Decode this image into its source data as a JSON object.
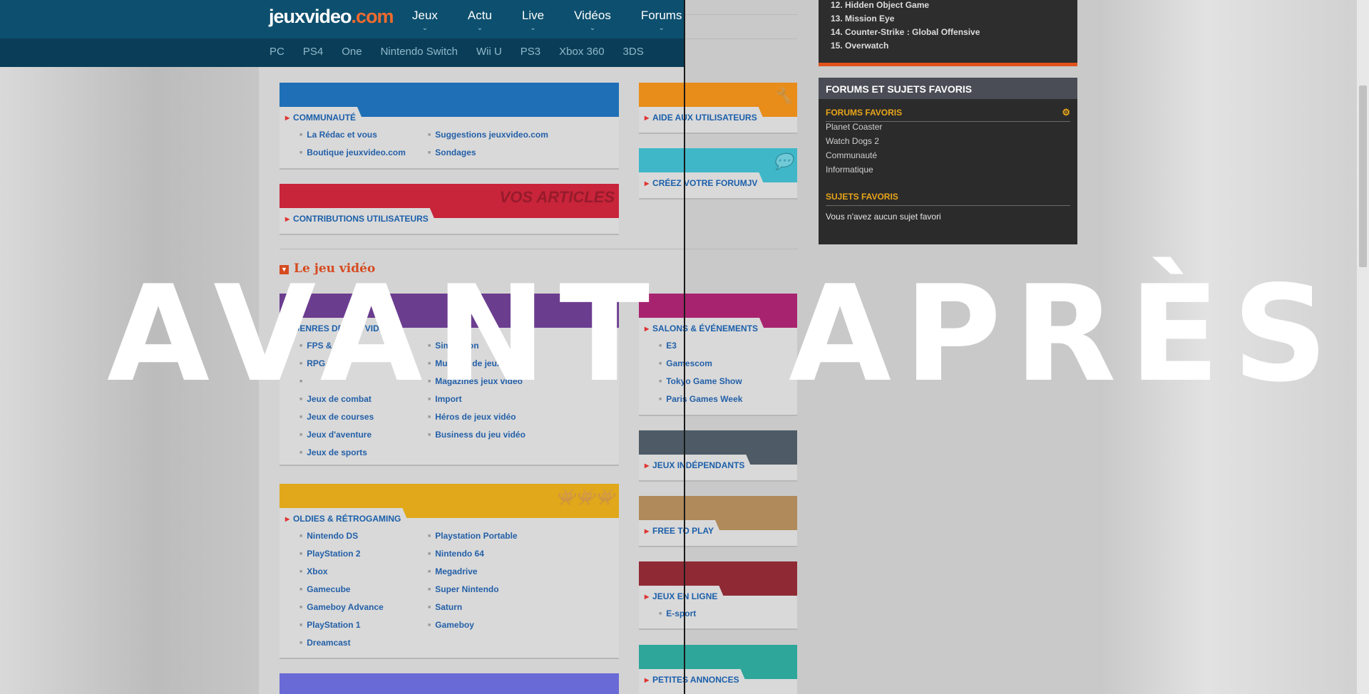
{
  "header": {
    "logo_main": "jeuxvideo",
    "logo_suffix": ".com",
    "nav": [
      "Jeux",
      "Actu",
      "Live",
      "Vidéos",
      "Forums"
    ],
    "subnav": [
      "PC",
      "PS4",
      "One",
      "Nintendo Switch",
      "Wii U",
      "PS3",
      "Xbox 360",
      "3DS"
    ]
  },
  "top_list": [
    "12. Hidden Object Game",
    "13. Mission Eye",
    "14. Counter-Strike : Global Offensive",
    "15. Overwatch"
  ],
  "cards": {
    "communaute": {
      "title": "COMMUNAUTÉ",
      "col1": [
        "La Rédac et vous",
        "Boutique jeuxvideo.com"
      ],
      "col2": [
        "Suggestions jeuxvideo.com",
        "Sondages"
      ]
    },
    "aide": {
      "title": "AIDE AUX UTILISATEURS"
    },
    "creez": {
      "title": "CRÉEZ VOTRE FORUMJV"
    },
    "contrib": {
      "title": "CONTRIBUTIONS UTILISATEURS",
      "art": "VOS ARTICLES"
    },
    "genres": {
      "title": "GENRES DE JEU VIDÉO",
      "col1": [
        "FPS & TPS",
        "RPG",
        "",
        "Jeux de combat",
        "Jeux de courses",
        "Jeux d'aventure",
        "Jeux de sports"
      ],
      "col2": [
        "Simulation",
        "Musique de jeux vidéo",
        "Magazines jeux vidéo",
        "Import",
        "Héros de jeux vidéo",
        "Business du jeu vidéo"
      ]
    },
    "salons": {
      "title": "SALONS & ÉVÉNEMENTS",
      "items": [
        "E3",
        "Gamescom",
        "Tokyo Game Show",
        "Paris Games Week"
      ]
    },
    "indep": {
      "title": "JEUX INDÉPENDANTS"
    },
    "oldies": {
      "title": "OLDIES & RÉTROGAMING",
      "col1": [
        "Nintendo DS",
        "PlayStation 2",
        "Xbox",
        "Gamecube",
        "Gameboy Advance",
        "PlayStation 1",
        "Dreamcast"
      ],
      "col2": [
        "Playstation Portable",
        "Nintendo 64",
        "Megadrive",
        "Super Nintendo",
        "Saturn",
        "Gameboy"
      ]
    },
    "f2p": {
      "title": "FREE TO PLAY"
    },
    "enligne": {
      "title": "JEUX EN LIGNE",
      "items": [
        "E-sport"
      ]
    },
    "annonces": {
      "title": "PETITES ANNONCES"
    }
  },
  "section": {
    "title": "Le jeu vidéo"
  },
  "sidebar": {
    "header": "FORUMS ET SUJETS FAVORIS",
    "forums_title": "FORUMS FAVORIS",
    "forums": [
      "Planet Coaster",
      "Watch Dogs 2",
      "Communauté",
      "Informatique"
    ],
    "sujets_title": "SUJETS FAVORIS",
    "sujets_empty": "Vous n'avez aucun sujet favori"
  },
  "overlay": {
    "before": "AVANT",
    "after": "APRÈS"
  },
  "colors": {
    "communaute": "#1e6fb5",
    "aide": "#e88c1a",
    "creez": "#3fb7c9",
    "contrib": "#c8243a",
    "genres": "#6b3d8f",
    "salons": "#a8236f",
    "indep": "#4e5b66",
    "oldies": "#e0a81a",
    "f2p": "#b08a5a",
    "enligne": "#8f2a35",
    "annonces": "#2ea69a",
    "versus": "#6a6ad6"
  }
}
